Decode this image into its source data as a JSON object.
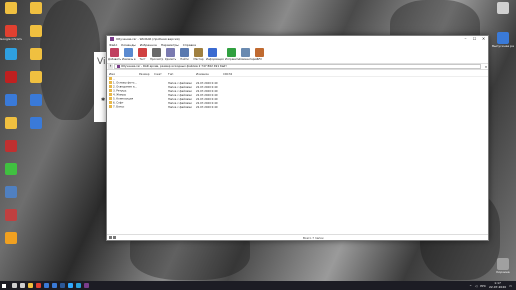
{
  "desktop": {
    "left_icons": [
      {
        "label": "",
        "color": "#f0c040"
      },
      {
        "label": "Google Chrome",
        "color": "#e04030"
      },
      {
        "label": "",
        "color": "#2fa0e0"
      },
      {
        "label": "",
        "color": "#c02020"
      },
      {
        "label": "",
        "color": "#3a7ad8"
      },
      {
        "label": "",
        "color": "#f0c040"
      },
      {
        "label": "",
        "color": "#c03030"
      },
      {
        "label": "",
        "color": "#40c040"
      },
      {
        "label": "",
        "color": "#5080c0"
      },
      {
        "label": "",
        "color": "#c04040"
      },
      {
        "label": "",
        "color": "#f0a020"
      }
    ],
    "second_column": [
      {
        "label": "",
        "color": "#f0c040"
      },
      {
        "label": "",
        "color": "#f0c040"
      },
      {
        "label": "",
        "color": "#f0c040"
      },
      {
        "label": "",
        "color": "#f0c040"
      },
      {
        "label": "",
        "color": "#3a7ad8"
      },
      {
        "label": "",
        "color": "#3a7ad8"
      }
    ],
    "right_icons": [
      {
        "label": "",
        "color": "#d0d0d0"
      },
      {
        "label": "Выпускная работа",
        "color": "#3a7ad8"
      },
      {
        "label": "Корзина",
        "color": "#a0a0a0"
      }
    ]
  },
  "behind_app": {
    "title": "Vi"
  },
  "window": {
    "title": "Обучение.rar - WinRAR (пробная версия)",
    "menu": [
      "Файл",
      "Команды",
      "Избранное",
      "Параметры",
      "Справка"
    ],
    "toolbar": [
      {
        "label": "Добавить",
        "icon": "add-archive-icon",
        "color": "#c04060"
      },
      {
        "label": "Извлечь в",
        "icon": "extract-icon",
        "color": "#5a8ad0"
      },
      {
        "label": "Тест",
        "icon": "test-icon",
        "color": "#d04040"
      },
      {
        "label": "Просмотр",
        "icon": "view-icon",
        "color": "#6a6a6a"
      },
      {
        "label": "Удалить",
        "icon": "delete-icon",
        "color": "#7a7ab0"
      },
      {
        "label": "Найти",
        "icon": "find-icon",
        "color": "#5a7ab0"
      },
      {
        "label": "Мастер",
        "icon": "wizard-icon",
        "color": "#a08040"
      },
      {
        "label": "Информация",
        "icon": "info-icon",
        "color": "#3a6ad0"
      },
      {
        "label": "Исправить",
        "icon": "repair-icon",
        "color": "#30a040"
      },
      {
        "label": "Комментарий",
        "icon": "comment-icon",
        "color": "#6a8ab0"
      },
      {
        "label": "SFX",
        "icon": "sfx-icon",
        "color": "#c06a30"
      }
    ],
    "address": "Обучение.rar - RAR архив, размер исходных файлов 2 747 862 491 байт",
    "columns": [
      "Имя",
      "Размер",
      "Сжат",
      "Тип",
      "Изменён",
      "CRC32"
    ],
    "rows": [
      {
        "name": "..",
        "size": "",
        "packed": "",
        "type": "",
        "modified": "",
        "crc": ""
      },
      {
        "name": "1. Основы фото...",
        "size": "",
        "packed": "",
        "type": "Папка с файлами",
        "modified": "22.07.2020 0:40",
        "crc": ""
      },
      {
        "name": "2. Освещение и...",
        "size": "",
        "packed": "",
        "type": "Папка с файлами",
        "modified": "22.07.2020 0:40",
        "crc": ""
      },
      {
        "name": "3. Ретушь",
        "size": "",
        "packed": "",
        "type": "Папка с файлами",
        "modified": "22.07.2020 0:40",
        "crc": ""
      },
      {
        "name": "4. Жанры",
        "size": "",
        "packed": "",
        "type": "Папка с файлами",
        "modified": "22.07.2020 0:40",
        "crc": ""
      },
      {
        "name": "5. Композиция",
        "size": "",
        "packed": "",
        "type": "Папка с файлами",
        "modified": "22.07.2020 0:40",
        "crc": ""
      },
      {
        "name": "6. Софт",
        "size": "",
        "packed": "",
        "type": "Папка с файлами",
        "modified": "22.07.2020 0:40",
        "crc": ""
      },
      {
        "name": "7. Бонус",
        "size": "",
        "packed": "",
        "type": "Папка с файлами",
        "modified": "22.07.2020 0:40",
        "crc": ""
      }
    ],
    "status_left": "",
    "status_right": "Всего 7 папок"
  },
  "taskbar": {
    "pinned": [
      {
        "icon": "search-icon",
        "color": "#cfcfcf"
      },
      {
        "icon": "task-view-icon",
        "color": "#cfcfcf"
      },
      {
        "icon": "explorer-icon",
        "color": "#f0c040"
      },
      {
        "icon": "chrome-icon",
        "color": "#e04030"
      },
      {
        "icon": "store-icon",
        "color": "#3a7ad8"
      },
      {
        "icon": "mail-icon",
        "color": "#3a7ad8"
      },
      {
        "icon": "word-icon",
        "color": "#2b5797"
      },
      {
        "icon": "photoshop-icon",
        "color": "#31a8ff"
      },
      {
        "icon": "telegram-icon",
        "color": "#2aa1da"
      },
      {
        "icon": "winrar-icon",
        "color": "#7a3d8c"
      }
    ],
    "time": "1:17",
    "date": "22.07.2020",
    "lang": "РУС"
  }
}
